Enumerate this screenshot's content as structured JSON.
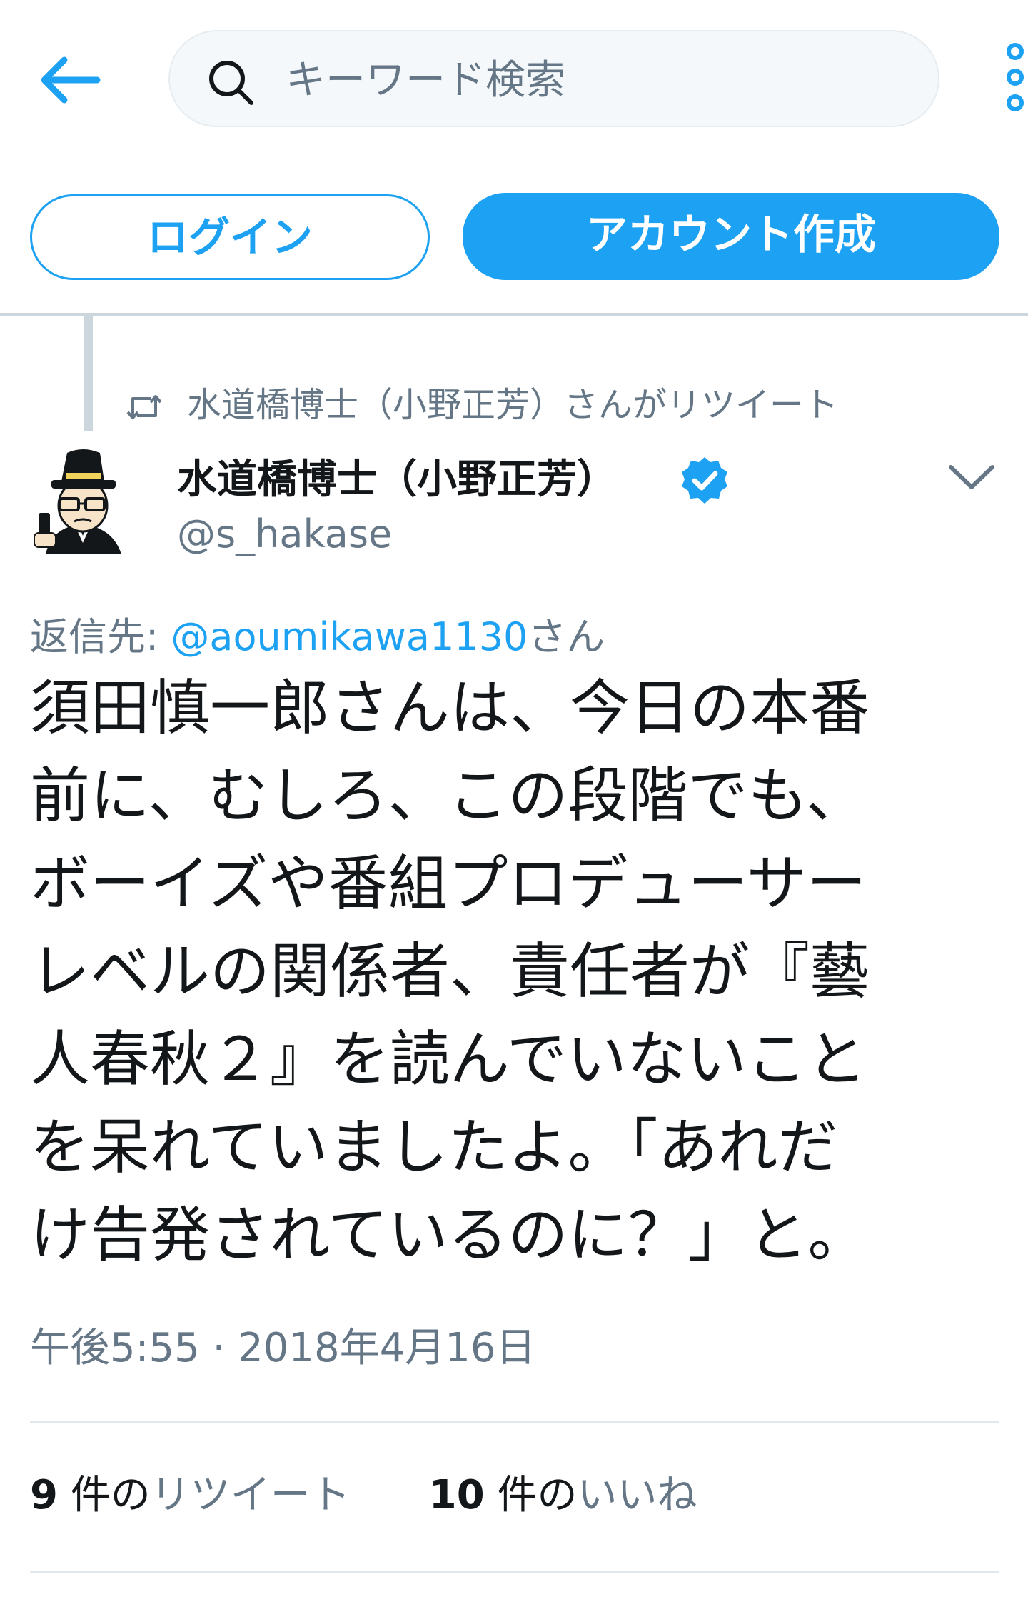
{
  "header": {
    "search_placeholder": "キーワード検索",
    "back_icon": "arrow-left-icon",
    "more_icon": "vertical-dots-icon"
  },
  "actions": {
    "login_label": "ログイン",
    "signup_label": "アカウント作成"
  },
  "tweet": {
    "retweet_context": "水道橋博士（小野正芳）さんがリツイート",
    "user_name": "水道橋博士（小野正芳）",
    "handle": "@s_hakase",
    "verified": true,
    "reply_prefix": "返信先: ",
    "reply_to": "@aoumikawa1130",
    "reply_suffix": "さん",
    "body": "須田慎一郎さんは、今日の本番\n前に、むしろ、この段階でも、\nボーイズや番組プロデューサー\nレベルの関係者、責任者が『藝\n人春秋２』を読んでいないこと\nを呆れていましたよ。「あれだ\nけ告発されているのに？」と。",
    "timestamp": "午後5:55 · 2018年4月16日",
    "retweets": {
      "count": "9",
      "suffix": " 件の",
      "label": "リツイート"
    },
    "likes": {
      "count": "10",
      "suffix": " 件の",
      "label": "いいね"
    }
  },
  "colors": {
    "accent": "#1da1f2",
    "secondary_text": "#657786",
    "primary_text": "#14171a",
    "divider": "#e1e8ed"
  }
}
